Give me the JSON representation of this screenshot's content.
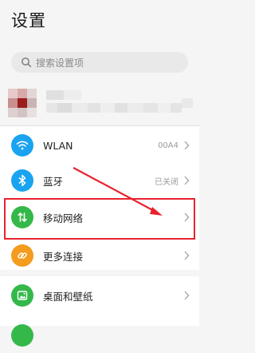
{
  "page": {
    "title": "设置"
  },
  "search": {
    "placeholder": "搜索设置项"
  },
  "settings": [
    {
      "label": "WLAN",
      "value": "00A4",
      "icon": "wifi-icon",
      "color": "#1aa3f0"
    },
    {
      "label": "蓝牙",
      "value": "已关闭",
      "icon": "bluetooth-icon",
      "color": "#1aa3f0"
    },
    {
      "label": "移动网络",
      "value": "",
      "icon": "mobile-data-icon",
      "color": "#35b84a"
    },
    {
      "label": "更多连接",
      "value": "",
      "icon": "link-icon",
      "color": "#f39c1e"
    }
  ],
  "settings2": [
    {
      "label": "桌面和壁纸",
      "icon": "wallpaper-icon",
      "color": "#35b84a"
    }
  ],
  "annotation": {
    "highlight_color": "#e8232f"
  }
}
